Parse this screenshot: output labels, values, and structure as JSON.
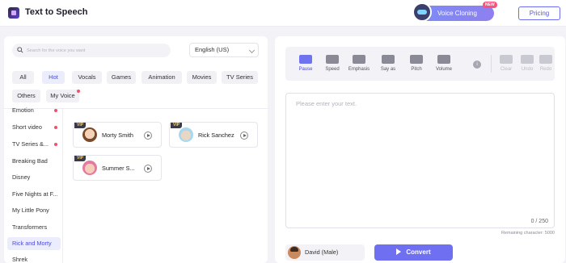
{
  "header": {
    "title": "Text to Speech",
    "voice_cloning_label": "Voice Cloning",
    "new_badge": "NEW",
    "pricing_label": "Pricing"
  },
  "search": {
    "placeholder": "Search for the voice you want"
  },
  "language": {
    "selected": "English (US)"
  },
  "tags": [
    {
      "label": "All"
    },
    {
      "label": "Hot",
      "active": true
    },
    {
      "label": "Vocals"
    },
    {
      "label": "Games"
    },
    {
      "label": "Animation"
    },
    {
      "label": "Movies"
    },
    {
      "label": "TV Series"
    },
    {
      "label": "Others"
    },
    {
      "label": "My Voice",
      "dot": true
    }
  ],
  "categories": [
    {
      "label": "Emotion",
      "dot": true
    },
    {
      "label": "Short video",
      "dot": true
    },
    {
      "label": "TV Series &...",
      "dot": true
    },
    {
      "label": "Breaking Bad"
    },
    {
      "label": "Disney"
    },
    {
      "label": "Five Nights at F..."
    },
    {
      "label": "My Little Pony"
    },
    {
      "label": "Transformers"
    },
    {
      "label": "Rick and Morty",
      "active": true
    },
    {
      "label": "Shrek"
    }
  ],
  "voices": [
    {
      "name": "Morty Smith",
      "badge": "VIP"
    },
    {
      "name": "Rick Sanchez",
      "badge": "VIP"
    },
    {
      "name": "Summer S...",
      "badge": "VIP"
    }
  ],
  "toolbar": {
    "pause": "Pause",
    "speed": "Speed",
    "emphasis": "Emphasis",
    "say_as": "Say as",
    "pitch": "Pitch",
    "volume": "Volume",
    "info": "i",
    "clear": "Clear",
    "undo": "Undo",
    "redo": "Redo"
  },
  "editor": {
    "placeholder": "Please enter your text.",
    "char_count": "0 / 250",
    "remaining": "Remaining character: 5000"
  },
  "selected_voice": {
    "label": "David (Male)"
  },
  "convert_label": "Convert",
  "colors": {
    "accent": "#6f6ff2",
    "active_bg": "#ecedfc",
    "notify_dot": "#f0506e"
  }
}
